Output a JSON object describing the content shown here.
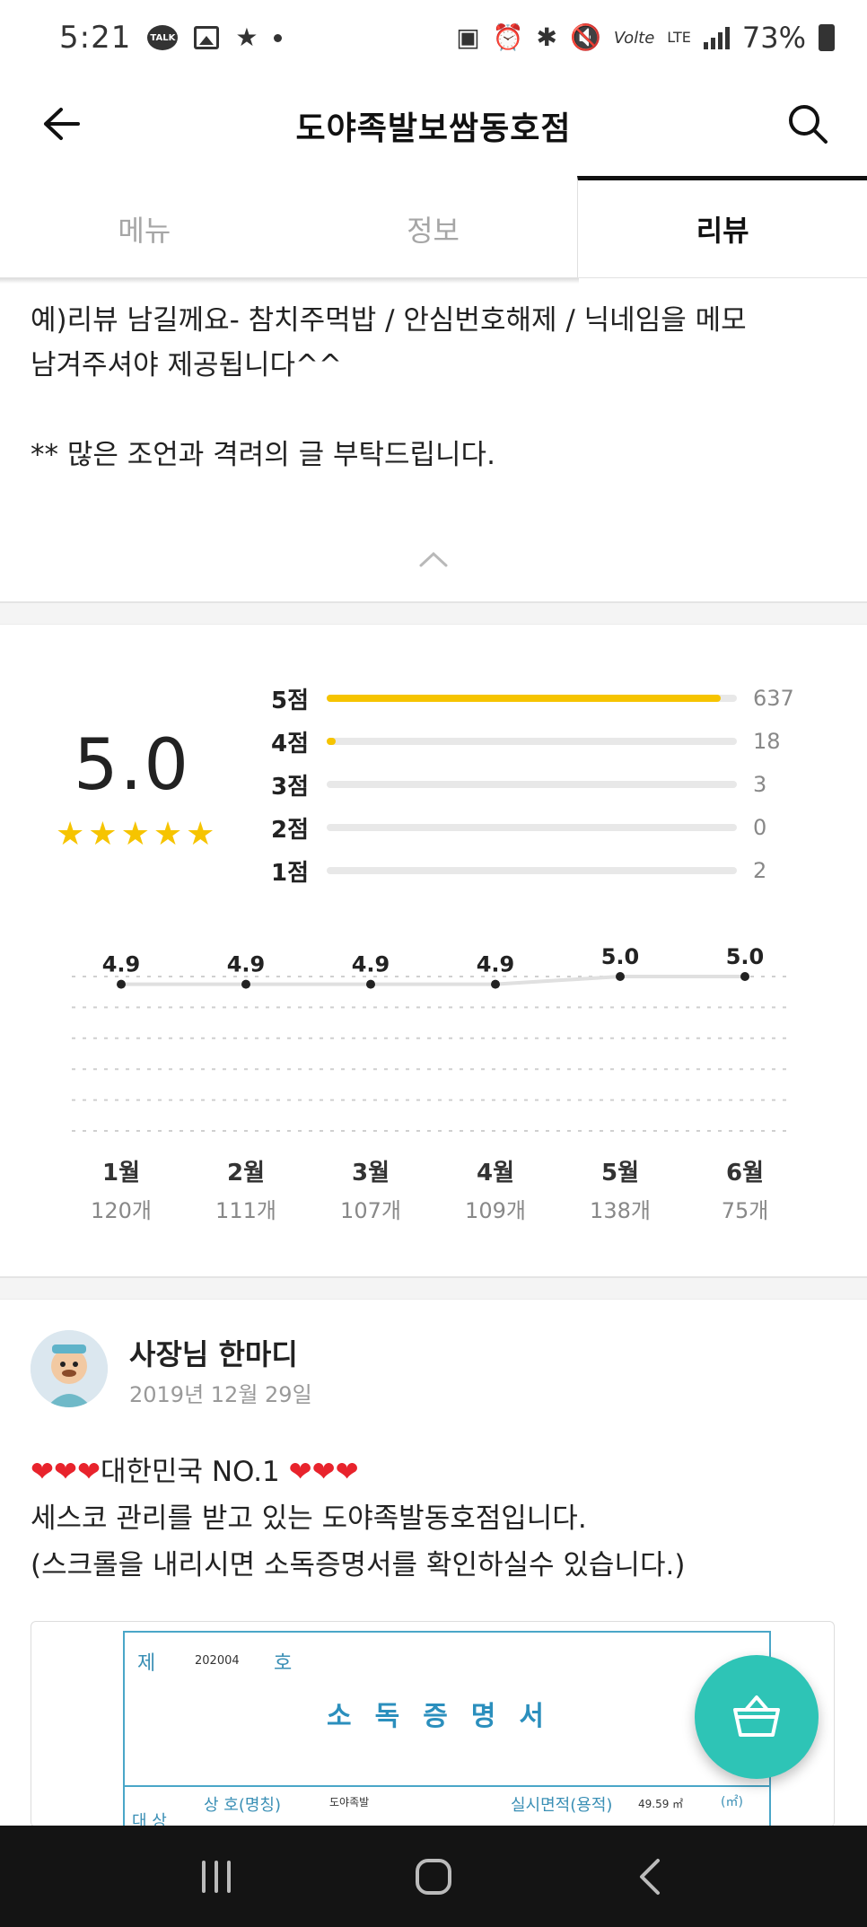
{
  "status_bar": {
    "time": "5:21",
    "talk_badge": "TALK",
    "volte": "Volte",
    "lte": "LTE",
    "battery": "73%"
  },
  "header": {
    "title": "도야족발보쌈동호점"
  },
  "tabs": [
    {
      "label": "메뉴",
      "active": false
    },
    {
      "label": "정보",
      "active": false
    },
    {
      "label": "리뷰",
      "active": true
    }
  ],
  "notice": {
    "line1": "예)리뷰 남길께요- 참치주먹밥 / 안심번호해제 / 닉네임을 메모",
    "line2": "남겨주셔야 제공됩니다^^",
    "line3": "** 많은 조언과 격려의 글 부탁드립니다."
  },
  "rating": {
    "value": "5.0",
    "stars": 5,
    "distribution": [
      {
        "label": "5점",
        "count": "637",
        "fraction": 0.96
      },
      {
        "label": "4점",
        "count": "18",
        "fraction": 0.02
      },
      {
        "label": "3점",
        "count": "3",
        "fraction": 0
      },
      {
        "label": "2점",
        "count": "0",
        "fraction": 0
      },
      {
        "label": "1점",
        "count": "2",
        "fraction": 0
      }
    ]
  },
  "chart_data": {
    "type": "line",
    "categories": [
      "1월",
      "2월",
      "3월",
      "4월",
      "5월",
      "6월"
    ],
    "series": [
      {
        "values": [
          4.9,
          4.9,
          4.9,
          4.9,
          5.0,
          5.0
        ]
      }
    ],
    "counts": [
      "120개",
      "111개",
      "107개",
      "109개",
      "138개",
      "75개"
    ],
    "ylim": [
      4.0,
      5.0
    ],
    "grid": true
  },
  "owner": {
    "name": "사장님 한마디",
    "date": "2019년 12월 29일",
    "hearts_left": "❤❤❤",
    "line1_text": "대한민국 NO.1",
    "hearts_right": "❤❤❤",
    "line2": "세스코 관리를 받고 있는 도야족발동호점입니다.",
    "line3": "(스크롤을 내리시면 소독증명서를 확인하실수 있습니다.)"
  },
  "certificate": {
    "no_prefix": "제",
    "number": "202004",
    "no_suffix": "호",
    "title": "소독증명서",
    "name_label": "상 호(명칭)",
    "name_value": "도야족발",
    "area_label": "실시면적(용적)",
    "area_value": "49.59 ㎡",
    "unit": "(㎡)",
    "side_label": "대 상"
  },
  "colors": {
    "accent_yellow": "#f6c400",
    "fab": "#2ec4b6",
    "heart": "#e8232c"
  }
}
